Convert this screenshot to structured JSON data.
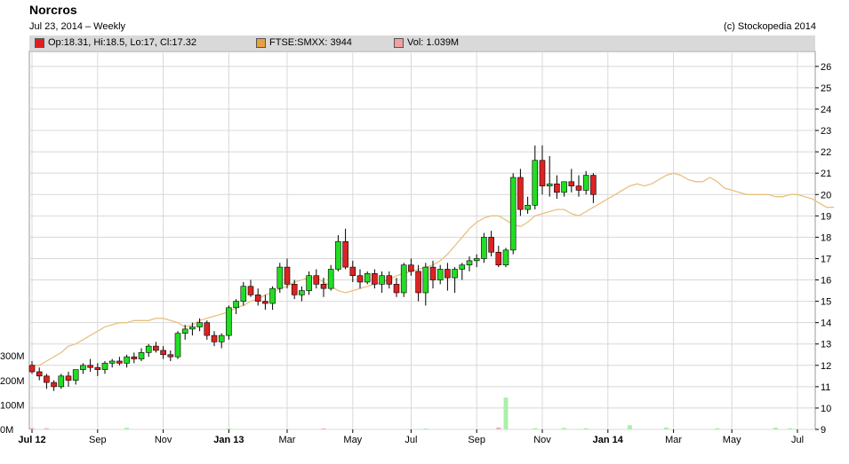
{
  "header": {
    "title": "Norcros",
    "subtitle": "Jul 23, 2014 – Weekly",
    "copyright": "(c) Stockopedia 2014"
  },
  "legend": [
    {
      "label": "Op:18.31, Hi:18.5, Lo:17, Cl:17.32",
      "color": "#e02020"
    },
    {
      "label": "FTSE:SMXX: 3944",
      "color": "#e8a040"
    },
    {
      "label": "Vol: 1.039M",
      "color": "#f0a0a0"
    }
  ],
  "colors": {
    "up": "#22dd22",
    "down": "#dd2222",
    "index_line": "#e8c080",
    "volume_up": "#aaf0aa",
    "volume_down": "#f5b0b0",
    "grid": "#d8d8d8"
  },
  "chart_data": {
    "type": "candlestick",
    "x_labels": [
      {
        "label": "Jul 12",
        "week": 0,
        "bold": true
      },
      {
        "label": "Sep",
        "week": 9,
        "bold": false
      },
      {
        "label": "Nov",
        "week": 18,
        "bold": false
      },
      {
        "label": "Jan 13",
        "week": 27,
        "bold": true
      },
      {
        "label": "Mar",
        "week": 35,
        "bold": false
      },
      {
        "label": "May",
        "week": 44,
        "bold": false
      },
      {
        "label": "Jul",
        "week": 52,
        "bold": false
      },
      {
        "label": "Sep",
        "week": 61,
        "bold": false
      },
      {
        "label": "Nov",
        "week": 70,
        "bold": false
      },
      {
        "label": "Jan 14",
        "week": 79,
        "bold": true
      },
      {
        "label": "Mar",
        "week": 88,
        "bold": false
      },
      {
        "label": "May",
        "week": 96,
        "bold": false
      },
      {
        "label": "Jul",
        "week": 105,
        "bold": false
      }
    ],
    "y_ticks": [
      9,
      10,
      11,
      12,
      13,
      14,
      15,
      16,
      17,
      18,
      19,
      20,
      21,
      22,
      23,
      24,
      25,
      26
    ],
    "y_range": [
      9,
      26.7
    ],
    "volume_ticks": [
      "0M",
      "100M",
      "200M",
      "300M"
    ],
    "volume_range_m": [
      0,
      300
    ],
    "index_series": [
      12.0,
      12.0,
      12.2,
      12.4,
      12.6,
      12.9,
      13.0,
      13.2,
      13.4,
      13.6,
      13.8,
      13.9,
      14.0,
      14.0,
      14.1,
      14.1,
      14.1,
      14.2,
      14.2,
      14.1,
      14.0,
      13.8,
      13.9,
      14.1,
      14.2,
      14.3,
      14.4,
      14.5,
      14.7,
      14.8,
      15.0,
      15.1,
      15.3,
      15.4,
      15.6,
      15.7,
      15.9,
      16.0,
      16.1,
      16.1,
      15.9,
      15.7,
      15.5,
      15.4,
      15.5,
      15.6,
      15.7,
      15.8,
      15.9,
      16.0,
      16.2,
      16.3,
      16.4,
      16.5,
      16.6,
      16.7,
      16.9,
      17.2,
      17.6,
      18.0,
      18.4,
      18.7,
      18.9,
      19.0,
      19.0,
      18.8,
      18.6,
      18.5,
      18.7,
      19.0,
      19.1,
      19.2,
      19.3,
      19.3,
      19.1,
      19.0,
      19.2,
      19.4,
      19.6,
      19.8,
      20.0,
      20.2,
      20.4,
      20.5,
      20.4,
      20.5,
      20.7,
      20.9,
      21.0,
      20.9,
      20.7,
      20.6,
      20.6,
      20.8,
      20.6,
      20.3,
      20.2,
      20.1,
      20.0,
      20.0,
      20.0,
      20.0,
      19.9,
      19.9,
      20.0,
      20.0,
      19.9,
      19.8,
      19.6,
      19.4,
      19.4
    ],
    "ohlc": [
      [
        12.0,
        12.2,
        11.6,
        11.7
      ],
      [
        11.7,
        11.9,
        11.3,
        11.5
      ],
      [
        11.5,
        11.6,
        10.9,
        11.2
      ],
      [
        11.2,
        11.3,
        10.8,
        11.0
      ],
      [
        11.0,
        11.6,
        10.9,
        11.5
      ],
      [
        11.5,
        11.7,
        11.0,
        11.3
      ],
      [
        11.3,
        11.8,
        11.1,
        11.8
      ],
      [
        11.8,
        12.1,
        11.6,
        12.0
      ],
      [
        12.0,
        12.3,
        11.7,
        11.9
      ],
      [
        11.9,
        12.1,
        11.5,
        11.8
      ],
      [
        11.8,
        12.2,
        11.6,
        12.1
      ],
      [
        12.1,
        12.3,
        11.9,
        12.2
      ],
      [
        12.2,
        12.4,
        12.0,
        12.1
      ],
      [
        12.1,
        12.5,
        11.9,
        12.4
      ],
      [
        12.4,
        12.6,
        12.1,
        12.3
      ],
      [
        12.3,
        12.8,
        12.2,
        12.6
      ],
      [
        12.6,
        13.0,
        12.4,
        12.9
      ],
      [
        12.9,
        13.1,
        12.6,
        12.7
      ],
      [
        12.7,
        12.9,
        12.3,
        12.5
      ],
      [
        12.5,
        12.7,
        12.2,
        12.4
      ],
      [
        12.4,
        13.6,
        12.3,
        13.5
      ],
      [
        13.5,
        13.9,
        13.2,
        13.7
      ],
      [
        13.7,
        14.0,
        13.4,
        13.8
      ],
      [
        13.8,
        14.2,
        13.6,
        14.0
      ],
      [
        14.0,
        14.1,
        13.2,
        13.4
      ],
      [
        13.4,
        13.6,
        12.9,
        13.1
      ],
      [
        13.1,
        13.5,
        12.8,
        13.4
      ],
      [
        13.4,
        14.8,
        13.2,
        14.7
      ],
      [
        14.7,
        15.1,
        14.4,
        15.0
      ],
      [
        15.0,
        15.9,
        14.8,
        15.7
      ],
      [
        15.7,
        16.0,
        15.2,
        15.3
      ],
      [
        15.3,
        15.6,
        14.8,
        15.0
      ],
      [
        15.0,
        15.3,
        14.6,
        14.9
      ],
      [
        14.9,
        15.7,
        14.6,
        15.6
      ],
      [
        15.6,
        16.8,
        15.4,
        16.6
      ],
      [
        16.6,
        17.0,
        15.6,
        15.8
      ],
      [
        15.8,
        16.0,
        15.1,
        15.3
      ],
      [
        15.3,
        15.7,
        15.0,
        15.5
      ],
      [
        15.5,
        16.4,
        15.3,
        16.2
      ],
      [
        16.2,
        16.5,
        15.6,
        15.8
      ],
      [
        15.8,
        16.1,
        15.2,
        15.6
      ],
      [
        15.6,
        16.7,
        15.5,
        16.5
      ],
      [
        16.5,
        18.1,
        16.4,
        17.8
      ],
      [
        17.8,
        18.4,
        16.5,
        16.6
      ],
      [
        16.6,
        16.9,
        15.9,
        16.2
      ],
      [
        16.2,
        16.5,
        15.6,
        15.9
      ],
      [
        15.9,
        16.4,
        15.8,
        16.3
      ],
      [
        16.3,
        16.5,
        15.6,
        15.8
      ],
      [
        15.8,
        16.4,
        15.4,
        16.2
      ],
      [
        16.2,
        16.4,
        15.6,
        15.8
      ],
      [
        15.8,
        16.1,
        15.2,
        15.4
      ],
      [
        15.4,
        16.8,
        15.2,
        16.7
      ],
      [
        16.7,
        17.0,
        16.2,
        16.4
      ],
      [
        16.4,
        16.7,
        15.0,
        15.4
      ],
      [
        15.4,
        16.8,
        14.8,
        16.6
      ],
      [
        16.6,
        16.9,
        15.6,
        16.0
      ],
      [
        16.0,
        16.7,
        15.8,
        16.5
      ],
      [
        16.5,
        16.8,
        15.5,
        16.1
      ],
      [
        16.1,
        16.6,
        15.4,
        16.5
      ],
      [
        16.5,
        16.8,
        16.0,
        16.7
      ],
      [
        16.7,
        17.1,
        16.4,
        16.9
      ],
      [
        16.9,
        17.2,
        16.6,
        17.0
      ],
      [
        17.0,
        18.2,
        16.8,
        18.0
      ],
      [
        18.0,
        18.3,
        17.1,
        17.3
      ],
      [
        17.3,
        17.6,
        16.6,
        16.7
      ],
      [
        16.7,
        17.5,
        16.6,
        17.4
      ],
      [
        17.4,
        21.0,
        17.2,
        20.8
      ],
      [
        20.8,
        21.2,
        19.0,
        19.3
      ],
      [
        19.3,
        19.9,
        19.1,
        19.5
      ],
      [
        19.5,
        22.3,
        19.3,
        21.6
      ],
      [
        21.6,
        22.3,
        20.0,
        20.4
      ],
      [
        20.4,
        21.8,
        19.9,
        20.5
      ],
      [
        20.5,
        20.9,
        19.8,
        20.1
      ],
      [
        20.1,
        20.6,
        19.9,
        20.6
      ],
      [
        20.6,
        21.2,
        20.1,
        20.4
      ],
      [
        20.4,
        20.9,
        19.9,
        20.2
      ],
      [
        20.2,
        21.1,
        20.0,
        20.9
      ],
      [
        20.9,
        21.0,
        19.6,
        20.0
      ]
    ],
    "volume_weeks": [
      0,
      2,
      13,
      27,
      40,
      54,
      64,
      65,
      69,
      73,
      76,
      82,
      87,
      94,
      102,
      104
    ],
    "volume_m": [
      6,
      5,
      7,
      4,
      4,
      4,
      8,
      130,
      5,
      6,
      5,
      17,
      8,
      5,
      7,
      5
    ]
  }
}
